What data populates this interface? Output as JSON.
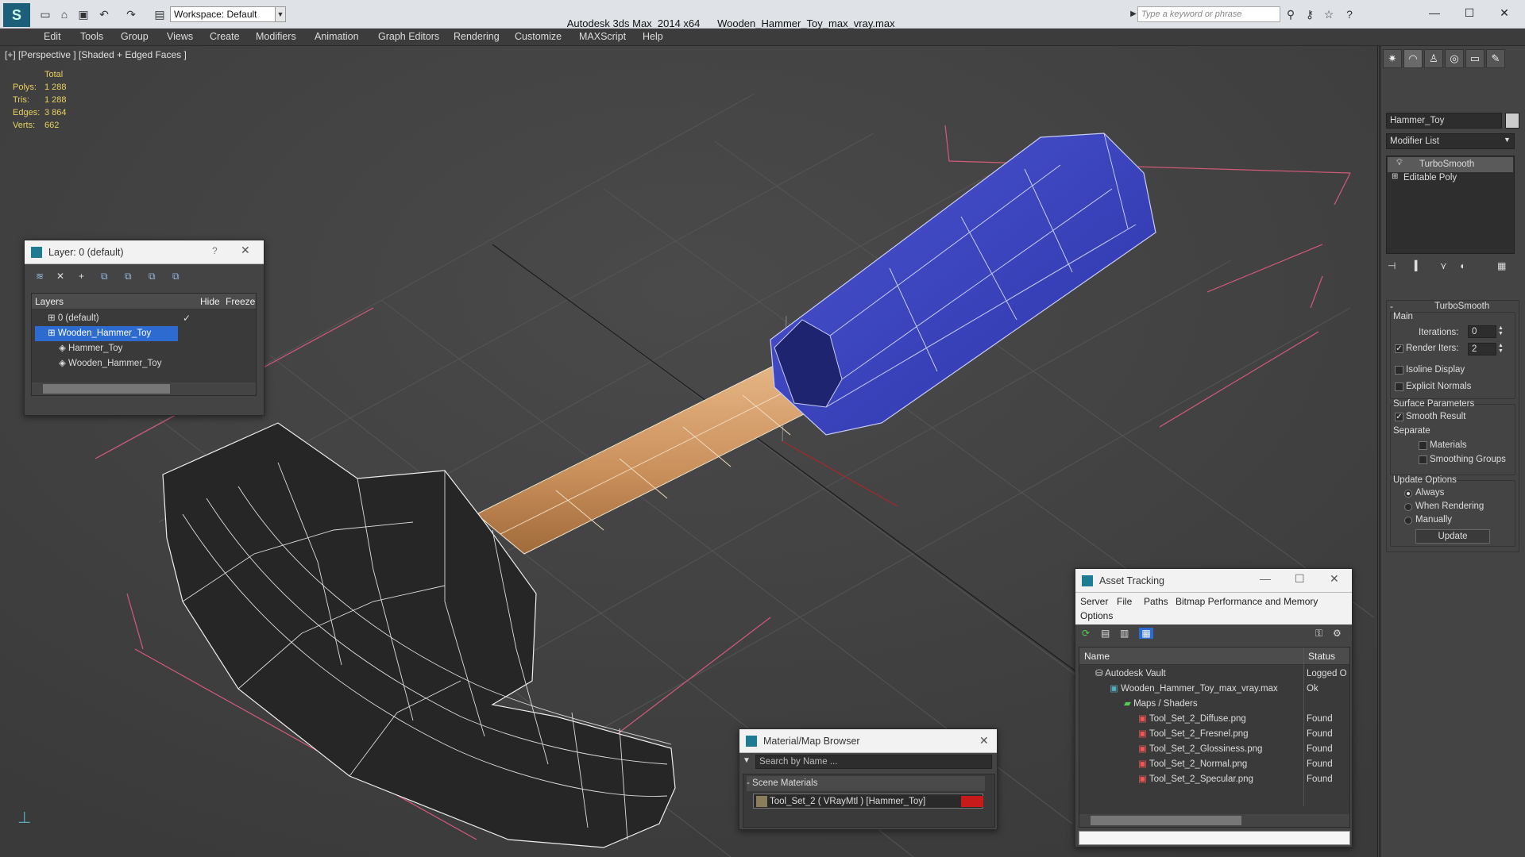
{
  "window": {
    "app_title": "Autodesk 3ds Max  2014 x64",
    "file_title": "Wooden_Hammer_Toy_max_vray.max",
    "workspace": "Workspace: Default",
    "search_placeholder": "Type a keyword or phrase"
  },
  "menu": [
    "Edit",
    "Tools",
    "Group",
    "Views",
    "Create",
    "Modifiers",
    "Animation",
    "Graph Editors",
    "Rendering",
    "Customize",
    "MAXScript",
    "Help"
  ],
  "viewport": {
    "label": "[+] [Perspective ] [Shaded + Edged Faces ]",
    "stats": {
      "total_label": "Total",
      "rows": [
        {
          "label": "Polys:",
          "value": "1 288"
        },
        {
          "label": "Tris:",
          "value": "1 288"
        },
        {
          "label": "Edges:",
          "value": "3 864"
        },
        {
          "label": "Verts:",
          "value": "662"
        }
      ]
    }
  },
  "layer_dialog": {
    "title": "Layer: 0 (default)",
    "help": "?",
    "col_layers": "Layers",
    "col_hide": "Hide",
    "col_freeze": "Freeze",
    "rows": [
      {
        "name": "0 (default)",
        "selected": false,
        "indent": 0
      },
      {
        "name": "Wooden_Hammer_Toy",
        "selected": true,
        "indent": 0
      },
      {
        "name": "Hammer_Toy",
        "selected": false,
        "indent": 1
      },
      {
        "name": "Wooden_Hammer_Toy",
        "selected": false,
        "indent": 1
      }
    ]
  },
  "command_panel": {
    "object_name": "Hammer_Toy",
    "modifier_list": "Modifier List",
    "stack": [
      "TurboSmooth",
      "Editable Poly"
    ],
    "rollout_title": "TurboSmooth",
    "main_label": "Main",
    "iterations_label": "Iterations:",
    "iterations_value": "0",
    "render_iters_label": "Render Iters:",
    "render_iters_value": "2",
    "isoline": "Isoline Display",
    "explicit_normals": "Explicit Normals",
    "surface_params": "Surface Parameters",
    "smooth_result": "Smooth Result",
    "separate": "Separate",
    "materials": "Materials",
    "smoothing_groups": "Smoothing Groups",
    "update_options": "Update Options",
    "always": "Always",
    "when_rendering": "When Rendering",
    "manually": "Manually",
    "update_button": "Update"
  },
  "material_browser": {
    "title": "Material/Map Browser",
    "search_placeholder": "Search by Name ...",
    "group": "- Scene Materials",
    "item": "Tool_Set_2  ( VRayMtl )  [Hammer_Toy]"
  },
  "asset_tracking": {
    "title": "Asset Tracking",
    "menu": [
      "Server",
      "File",
      "Paths",
      "Bitmap Performance and Memory"
    ],
    "menu2": "Options",
    "col_name": "Name",
    "col_status": "Status",
    "rows": [
      {
        "name": "Autodesk Vault",
        "status": "Logged O",
        "indent": 1
      },
      {
        "name": "Wooden_Hammer_Toy_max_vray.max",
        "status": "Ok",
        "indent": 2
      },
      {
        "name": "Maps / Shaders",
        "status": "",
        "indent": 3
      },
      {
        "name": "Tool_Set_2_Diffuse.png",
        "status": "Found",
        "indent": 4
      },
      {
        "name": "Tool_Set_2_Fresnel.png",
        "status": "Found",
        "indent": 4
      },
      {
        "name": "Tool_Set_2_Glossiness.png",
        "status": "Found",
        "indent": 4
      },
      {
        "name": "Tool_Set_2_Normal.png",
        "status": "Found",
        "indent": 4
      },
      {
        "name": "Tool_Set_2_Specular.png",
        "status": "Found",
        "indent": 4
      }
    ]
  }
}
